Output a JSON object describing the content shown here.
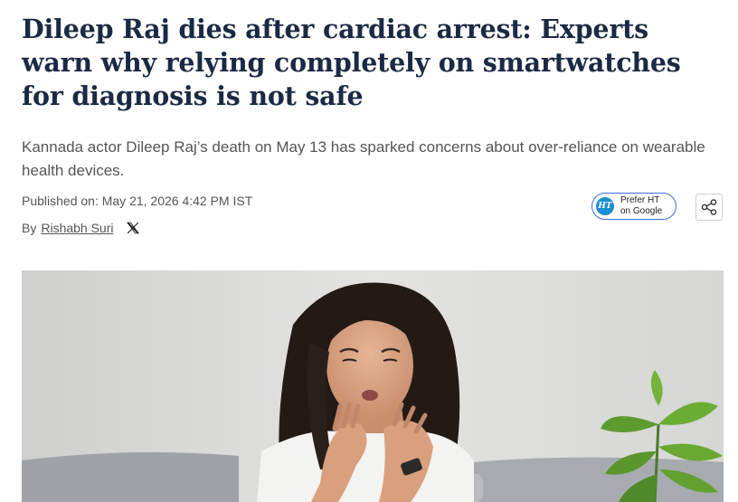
{
  "article": {
    "headline": "Dileep Raj dies after cardiac arrest: Experts warn why relying completely on smartwatches for diagnosis is not safe",
    "summary": "Kannada actor Dileep Raj’s death on May 13 has sparked concerns about over-reliance on wearable health devices.",
    "published": "Published on: May 21, 2026 4:42 PM IST",
    "by_prefix": "By",
    "author": "Rishabh Suri"
  },
  "actions": {
    "prefer_line1": "Prefer HT",
    "prefer_line2": "on Google",
    "ht_logo_text": "HT",
    "share_icon": "share-icon",
    "x_icon": "x-icon"
  },
  "colors": {
    "headline": "#1b2a44",
    "body_text": "#555555",
    "prefer_border": "#3b6fd8",
    "ht_logo_bg": "#1a8fd3"
  }
}
